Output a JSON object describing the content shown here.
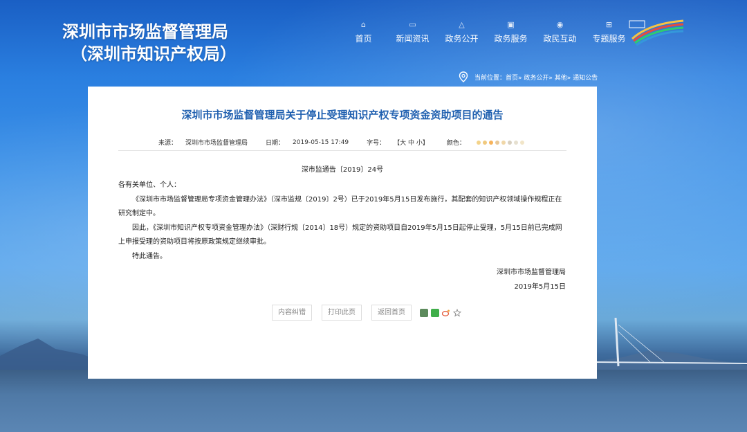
{
  "header": {
    "title_line1": "深圳市市场监督管理局",
    "title_line2": "（深圳市知识产权局）",
    "nav": [
      {
        "label": "首页",
        "icon": "home-icon"
      },
      {
        "label": "新闻资讯",
        "icon": "news-icon"
      },
      {
        "label": "政务公开",
        "icon": "open-gov-icon"
      },
      {
        "label": "政务服务",
        "icon": "service-icon"
      },
      {
        "label": "政民互动",
        "icon": "interaction-icon"
      },
      {
        "label": "专题服务",
        "icon": "topic-icon"
      }
    ]
  },
  "breadcrumb": {
    "text": "当前位置：首页» 政务公开» 其他» 通知公告"
  },
  "article": {
    "title": "深圳市市场监督管理局关于停止受理知识产权专项资金资助项目的通告",
    "meta": {
      "source_label": "来源：",
      "source_value": "深圳市市场监督管理局",
      "date_label": "日期：",
      "date_value": "2019-05-15 17:49",
      "font_label": "字号：",
      "font_options": "【大  中  小】",
      "color_label": "颜色："
    },
    "doc_number": "深市监通告〔2019〕24号",
    "salutation": "各有关单位、个人：",
    "paragraphs": [
      "《深圳市市场监督管理局专项资金管理办法》（深市监规〔2019〕2号）已于2019年5月15日发布施行，其配套的知识产权领域操作规程正在研究制定中。",
      "因此，《深圳市知识产权专项资金管理办法》（深财行规〔2014〕18号）规定的资助项目自2019年5月15日起停止受理，5月15日前已完成网上申报受理的资助项目将按原政策规定继续审批。",
      "特此通告。"
    ],
    "signature_org": "深圳市市场监督管理局",
    "signature_date": "2019年5月15日"
  },
  "actions": {
    "correct_label": "内容纠错",
    "print_label": "打印此页",
    "back_label": "返回首页"
  },
  "colors": {
    "title_blue": "#2060b0",
    "swatches": [
      "#f3d38a",
      "#f0c97e",
      "#f7b35a",
      "#e8c796",
      "#f0d7a8",
      "#d8d0c0",
      "#e6e0d0",
      "#f1e5c8"
    ]
  }
}
